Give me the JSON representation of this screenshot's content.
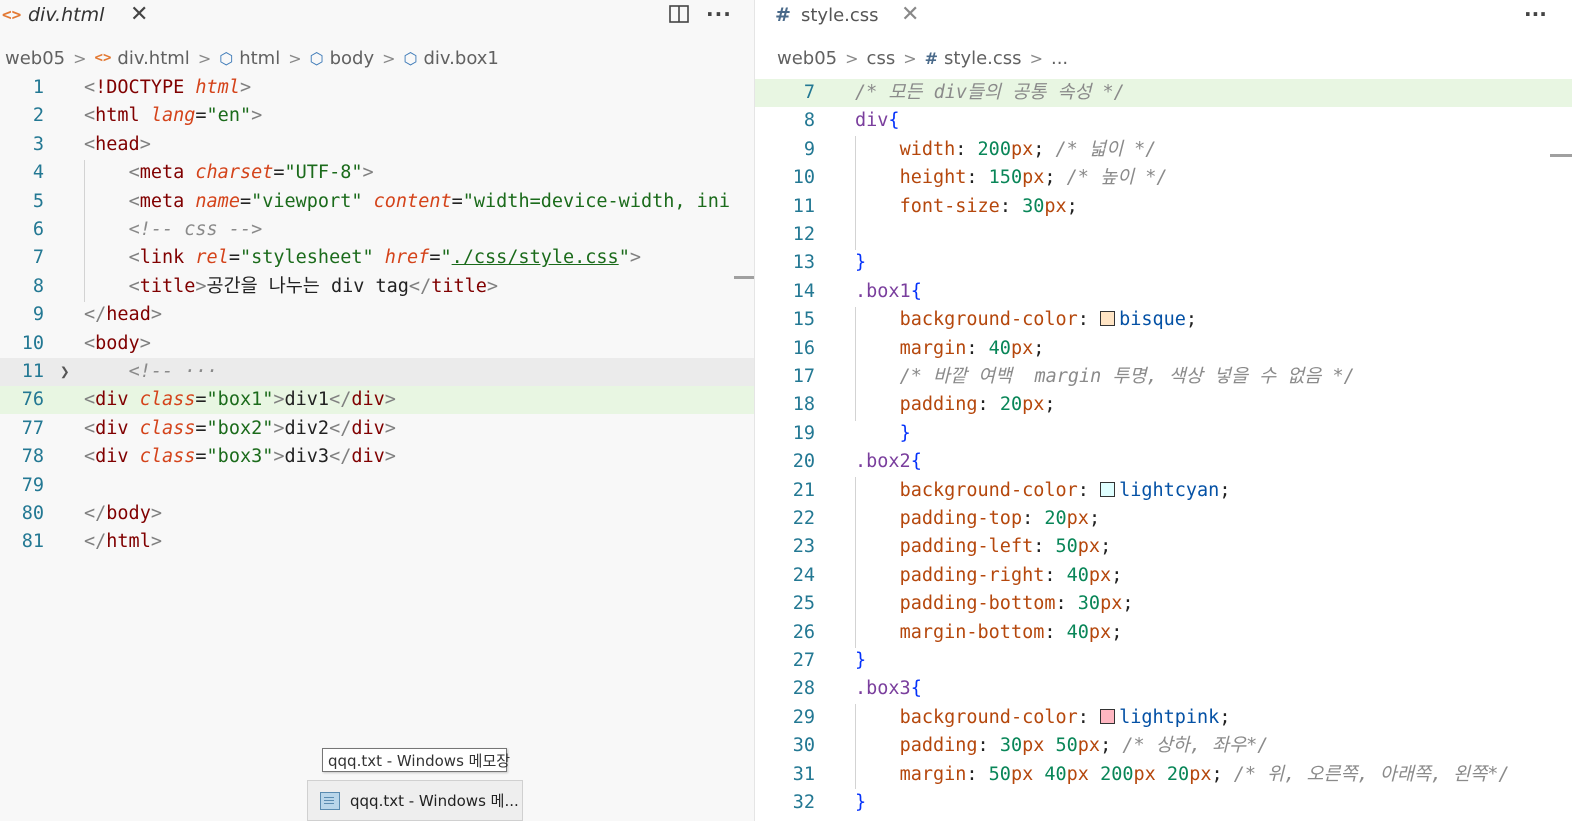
{
  "left_editor": {
    "tab": {
      "icon": "html-file-icon",
      "name": "div.html"
    },
    "actions": [
      "split-editor-icon",
      "more-actions-icon"
    ],
    "breadcrumb": [
      {
        "label": "web05",
        "icon": ""
      },
      {
        "label": "div.html",
        "icon": "html-file-icon"
      },
      {
        "label": "html",
        "icon": "symbol-element-icon"
      },
      {
        "label": "body",
        "icon": "symbol-element-icon"
      },
      {
        "label": "div.box1",
        "icon": "symbol-element-icon"
      }
    ],
    "lines": [
      {
        "n": "1",
        "text": "<!DOCTYPE html>"
      },
      {
        "n": "2",
        "text": "<html lang=\"en\">"
      },
      {
        "n": "3",
        "text": "<head>"
      },
      {
        "n": "4",
        "text": "    <meta charset=\"UTF-8\">"
      },
      {
        "n": "5",
        "text": "    <meta name=\"viewport\" content=\"width=device-width, init"
      },
      {
        "n": "6",
        "text": "    <!-- css -->"
      },
      {
        "n": "7",
        "text": "    <link rel=\"stylesheet\" href=\"./css/style.css\">"
      },
      {
        "n": "8",
        "text": "    <title>공간을 나누는 div tag</title>"
      },
      {
        "n": "9",
        "text": "</head>"
      },
      {
        "n": "10",
        "text": "<body>"
      },
      {
        "n": "11",
        "text": "    <!-- ···"
      },
      {
        "n": "76",
        "text": "<div class=\"box1\">div1</div>"
      },
      {
        "n": "77",
        "text": "<div class=\"box2\">div2</div>"
      },
      {
        "n": "78",
        "text": "<div class=\"box3\">div3</div>"
      },
      {
        "n": "79",
        "text": ""
      },
      {
        "n": "80",
        "text": "</body>"
      },
      {
        "n": "81",
        "text": "</html>"
      }
    ]
  },
  "right_editor": {
    "tab": {
      "icon": "css-file-icon",
      "name": "style.css"
    },
    "actions": [
      "more-actions-icon"
    ],
    "breadcrumb": [
      {
        "label": "web05",
        "icon": ""
      },
      {
        "label": "css",
        "icon": ""
      },
      {
        "label": "style.css",
        "icon": "css-file-icon"
      },
      {
        "label": "...",
        "icon": ""
      }
    ],
    "lines": [
      {
        "n": "7",
        "text": "/* 모든 div들의 공통 속성 */"
      },
      {
        "n": "8",
        "text": "div{"
      },
      {
        "n": "9",
        "text": "    width: 200px; /* 넓이 */"
      },
      {
        "n": "10",
        "text": "    height: 150px; /* 높이 */"
      },
      {
        "n": "11",
        "text": "    font-size: 30px;"
      },
      {
        "n": "12",
        "text": ""
      },
      {
        "n": "13",
        "text": "}"
      },
      {
        "n": "14",
        "text": ".box1{"
      },
      {
        "n": "15",
        "text": "    background-color: bisque;"
      },
      {
        "n": "16",
        "text": "    margin: 40px;"
      },
      {
        "n": "17",
        "text": "    /* 바깥 여백  margin 투명, 색상 넣을 수 없음 */"
      },
      {
        "n": "18",
        "text": "    padding: 20px;"
      },
      {
        "n": "19",
        "text": "    }"
      },
      {
        "n": "20",
        "text": ".box2{"
      },
      {
        "n": "21",
        "text": "    background-color: lightcyan;"
      },
      {
        "n": "22",
        "text": "    padding-top: 20px;"
      },
      {
        "n": "23",
        "text": "    padding-left: 50px;"
      },
      {
        "n": "24",
        "text": "    padding-right: 40px;"
      },
      {
        "n": "25",
        "text": "    padding-bottom: 30px;"
      },
      {
        "n": "26",
        "text": "    margin-bottom: 40px;"
      },
      {
        "n": "27",
        "text": "}"
      },
      {
        "n": "28",
        "text": ".box3{"
      },
      {
        "n": "29",
        "text": "    background-color: lightpink;"
      },
      {
        "n": "30",
        "text": "    padding: 30px 50px; /* 상하, 좌우*/"
      },
      {
        "n": "31",
        "text": "    margin: 50px 40px 200px 20px; /* 위, 오른쪽, 아래쪽, 왼쪽*/"
      },
      {
        "n": "32",
        "text": "}"
      }
    ],
    "swatch_colors": {
      "bisque": "#ffe4c4",
      "lightcyan": "#e0ffff",
      "lightpink": "#ffb6c1"
    }
  },
  "taskbar": {
    "tooltip": "qqq.txt - Windows 메모장",
    "preview_label": "qqq.txt - Windows 메...",
    "preview_icon": "notepad-icon"
  },
  "colors": {
    "highlight_line": "#e8f6e2",
    "folded_line": "#ebebeb",
    "line_number": "#237893"
  }
}
